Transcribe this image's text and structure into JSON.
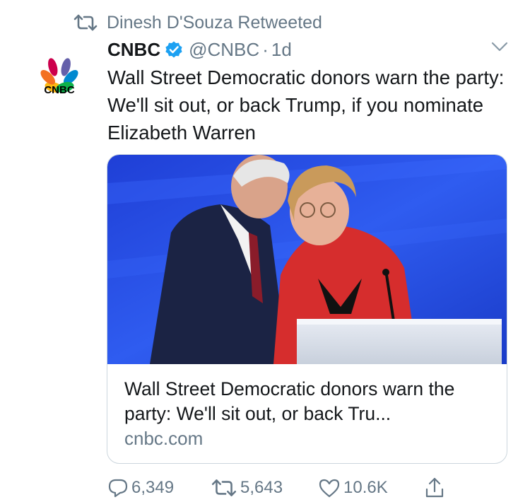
{
  "retweet_context": {
    "text": "Dinesh D'Souza Retweeted",
    "icon": "retweet-icon"
  },
  "tweet": {
    "author_name": "CNBC",
    "verified": true,
    "handle": "@CNBC",
    "separator": "·",
    "time": "1d",
    "avatar_logo_text": "CNBC",
    "text": "Wall Street Democratic donors warn the party: We'll sit out, or back Trump, if you nominate Elizabeth Warren"
  },
  "card": {
    "title": "Wall Street Democratic donors warn the party: We'll sit out, or back Tru...",
    "domain": "cnbc.com"
  },
  "actions": {
    "reply_count": "6,349",
    "retweet_count": "5,643",
    "like_count": "10.6K"
  },
  "colors": {
    "text": "#14171a",
    "secondary": "#657786",
    "verified": "#1da1f2",
    "border": "#ccd6dd"
  }
}
